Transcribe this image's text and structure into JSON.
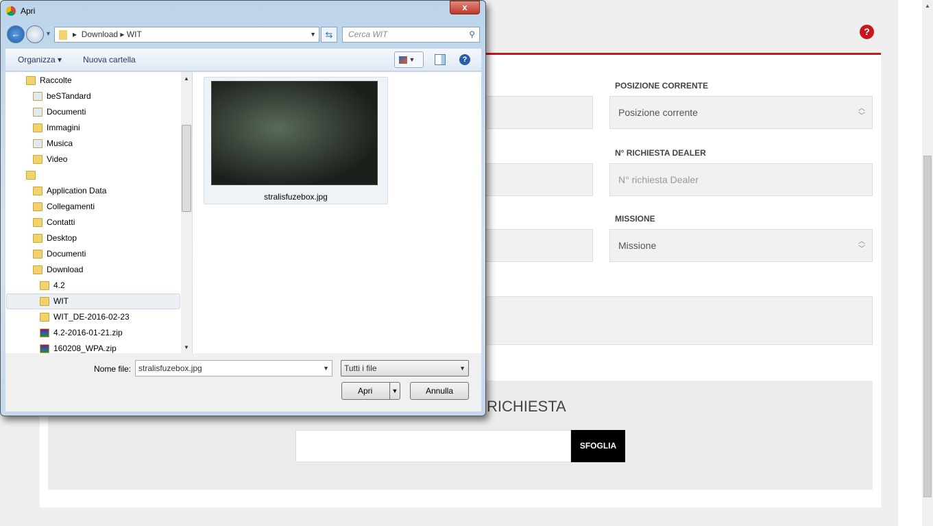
{
  "page": {
    "help_icon": "question-circle-icon",
    "accent": "#c8161d",
    "fields": [
      {
        "label": "POSIZIONE CORRENTE",
        "value": "Posizione corrente",
        "type": "select"
      },
      {
        "label": "N° RICHIESTA DEALER",
        "placeholder": "N° richiesta Dealer",
        "type": "input"
      },
      {
        "label": "MISSIONE",
        "value": "Missione",
        "type": "select"
      }
    ],
    "upload": {
      "title": "RICHIESTA",
      "browse_label": "SFOGLIA"
    }
  },
  "dialog": {
    "title": "Apri",
    "close_label": "x",
    "breadcrumb": [
      "Download",
      "WIT"
    ],
    "search_placeholder": "Cerca WIT",
    "toolbar": {
      "organize": "Organizza ▾",
      "new_folder": "Nuova cartella"
    },
    "tree": [
      {
        "label": "Raccolte",
        "level": 0,
        "icon": "libraries-icon"
      },
      {
        "label": "beSTandard",
        "level": 1,
        "icon": "library-icon"
      },
      {
        "label": "Documenti",
        "level": 1,
        "icon": "documents-icon"
      },
      {
        "label": "Immagini",
        "level": 1,
        "icon": "pictures-icon"
      },
      {
        "label": "Musica",
        "level": 1,
        "icon": "music-icon"
      },
      {
        "label": "Video",
        "level": 1,
        "icon": "video-icon"
      },
      {
        "label": "",
        "level": 0,
        "icon": "user-folder-icon"
      },
      {
        "label": "Application Data",
        "level": 1,
        "icon": "folder-icon"
      },
      {
        "label": "Collegamenti",
        "level": 1,
        "icon": "links-folder-icon"
      },
      {
        "label": "Contatti",
        "level": 1,
        "icon": "contacts-folder-icon"
      },
      {
        "label": "Desktop",
        "level": 1,
        "icon": "desktop-folder-icon"
      },
      {
        "label": "Documenti",
        "level": 1,
        "icon": "documents-folder-icon"
      },
      {
        "label": "Download",
        "level": 1,
        "icon": "downloads-folder-icon"
      },
      {
        "label": "4.2",
        "level": 2,
        "icon": "folder-icon"
      },
      {
        "label": "WIT",
        "level": 2,
        "icon": "folder-icon",
        "selected": true
      },
      {
        "label": "WIT_DE-2016-02-23",
        "level": 2,
        "icon": "folder-icon"
      },
      {
        "label": "4.2-2016-01-21.zip",
        "level": 2,
        "icon": "zip-icon"
      },
      {
        "label": "160208_WPA.zip",
        "level": 2,
        "icon": "zip-icon"
      }
    ],
    "file": {
      "name": "stralisfuzebox.jpg"
    },
    "filename_label": "Nome file:",
    "filename_value": "stralisfuzebox.jpg",
    "filetype": "Tutti i file",
    "open_label": "Apri",
    "cancel_label": "Annulla"
  }
}
